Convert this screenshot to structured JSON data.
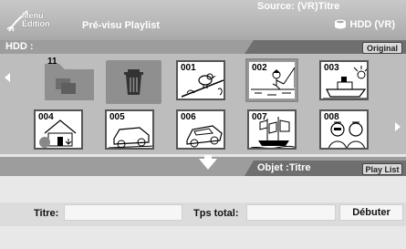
{
  "header": {
    "logo_line1": "Menu",
    "logo_line2": "Édition",
    "title": "Pré-visu Playlist",
    "hdd_label": "HDD (VR)",
    "hdd_icon": "hdd-icon"
  },
  "source_bar": {
    "left_label": "HDD :",
    "source_label": "Source: (VR)Titre",
    "original_button": "Original"
  },
  "grid": {
    "folder_number": "11",
    "thumbnails": [
      {
        "num": "001",
        "icon": "bird-on-branch"
      },
      {
        "num": "002",
        "icon": "fishing-boy",
        "selected": true
      },
      {
        "num": "003",
        "icon": "ship"
      },
      {
        "num": "004",
        "icon": "house"
      },
      {
        "num": "005",
        "icon": "car"
      },
      {
        "num": "006",
        "icon": "car"
      },
      {
        "num": "007",
        "icon": "sailing-ship"
      },
      {
        "num": "008",
        "icon": "people"
      }
    ]
  },
  "object_bar": {
    "object_label": "Objet :Titre",
    "playlist_button": "Play List"
  },
  "footer": {
    "titre_label": "Titre:",
    "tps_total_label": "Tps total:",
    "debuter_button": "Débuter"
  }
}
